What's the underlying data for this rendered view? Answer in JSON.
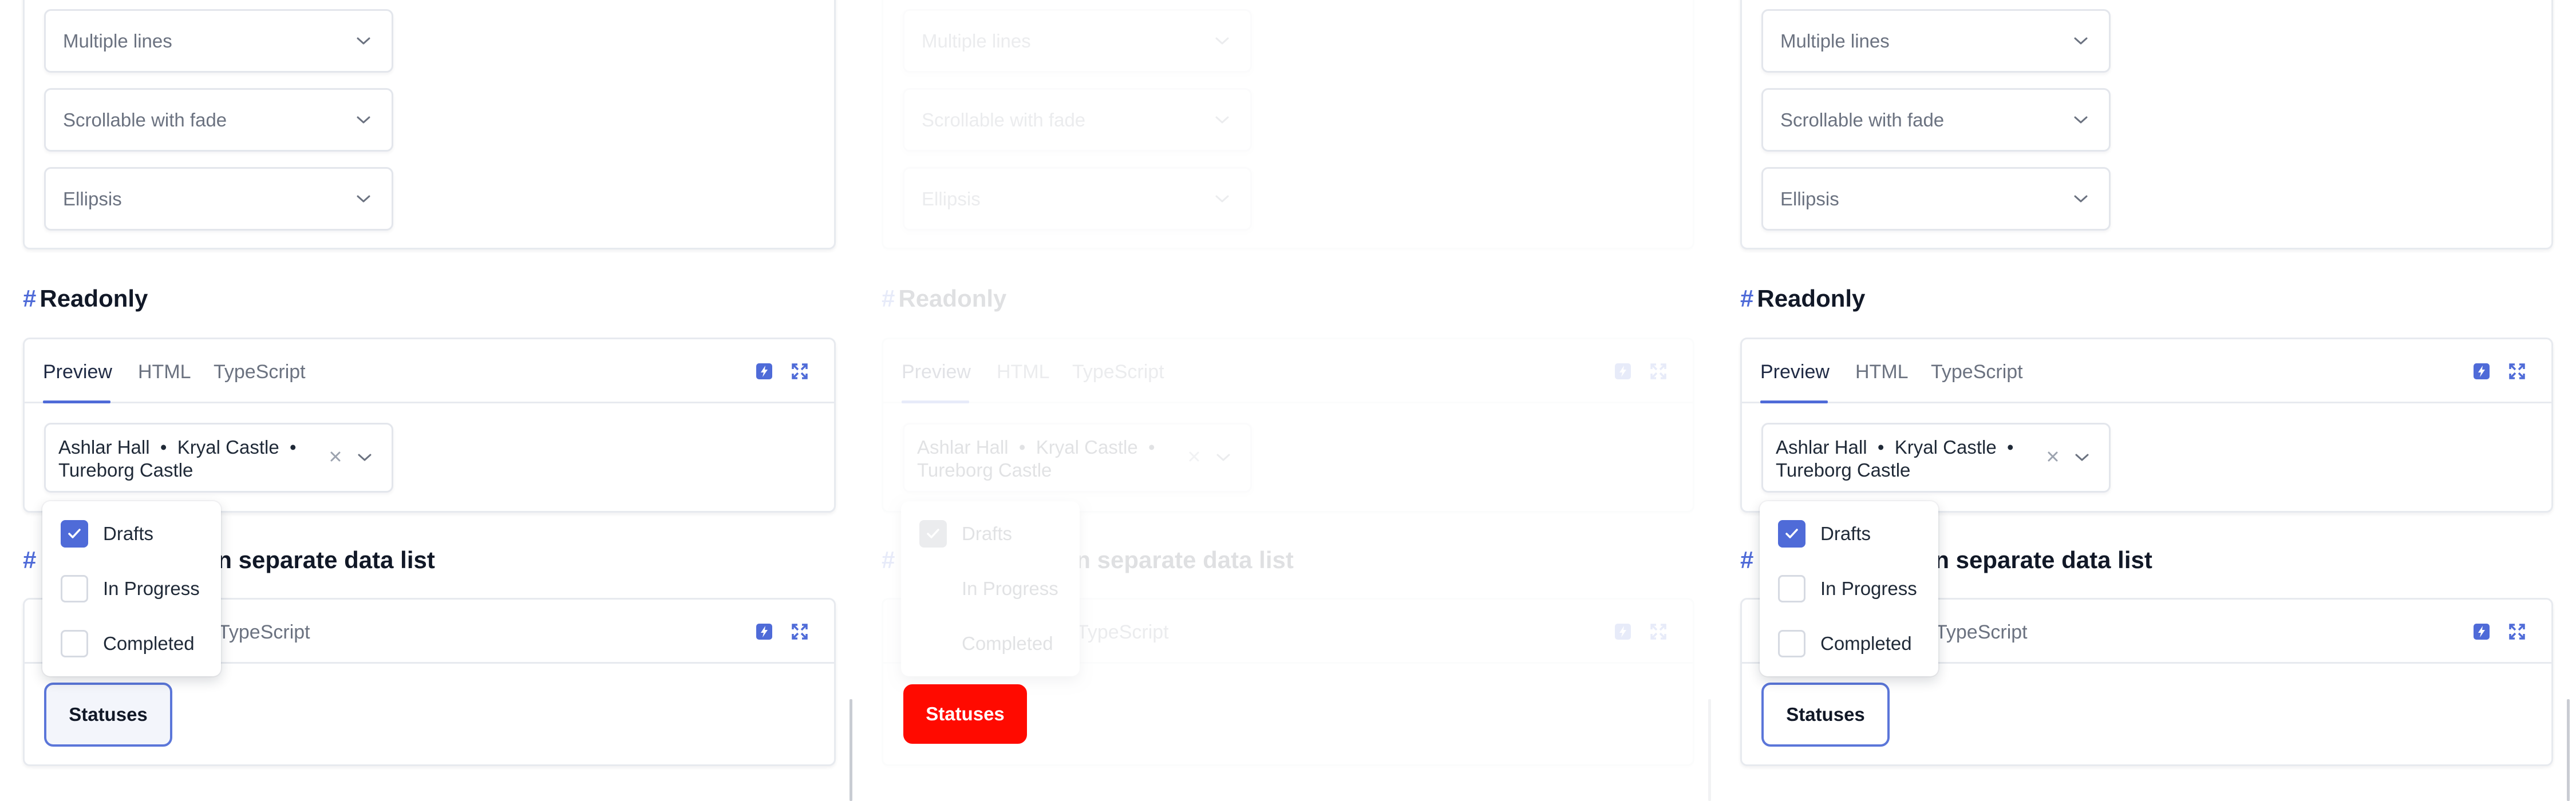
{
  "panels": [
    {
      "id": "left",
      "variant": "normal",
      "top_selects": [
        "Multiple lines",
        "Scrollable with fade",
        "Ellipsis"
      ],
      "readonly_section": {
        "title": "Readonly",
        "tabs": [
          "Preview",
          "HTML",
          "TypeScript"
        ],
        "selected_text": "Ashlar Hall  •  Kryal Castle  •  Tureborg Castle"
      },
      "datalist_section": {
        "title_visible": "n separate data list",
        "tab_visible": "TypeScript",
        "button_label": "Statuses"
      },
      "dropdown": {
        "options": [
          {
            "label": "Drafts",
            "checked": true
          },
          {
            "label": "In Progress",
            "checked": false
          },
          {
            "label": "Completed",
            "checked": false
          }
        ]
      }
    },
    {
      "id": "middle",
      "variant": "faded",
      "top_selects": [
        "Multiple lines",
        "Scrollable with fade",
        "Ellipsis"
      ],
      "readonly_section": {
        "title": "Readonly",
        "tabs": [
          "Preview",
          "HTML",
          "TypeScript"
        ],
        "selected_text": "Ashlar Hall  •  Kryal Castle  •  Tureborg Castle"
      },
      "datalist_section": {
        "title_visible": "n separate data list",
        "tab_visible": "TypeScript",
        "button_label": "Statuses"
      },
      "dropdown": {
        "options": [
          {
            "label": "Drafts",
            "checked": true
          },
          {
            "label": "In Progress",
            "checked": false
          },
          {
            "label": "Completed",
            "checked": false
          }
        ]
      }
    },
    {
      "id": "right",
      "variant": "normal",
      "top_selects": [
        "Multiple lines",
        "Scrollable with fade",
        "Ellipsis"
      ],
      "readonly_section": {
        "title": "Readonly",
        "tabs": [
          "Preview",
          "HTML",
          "TypeScript"
        ],
        "selected_text": "Ashlar Hall  •  Kryal Castle  •  Tureborg Castle"
      },
      "datalist_section": {
        "title_visible": "n separate data list",
        "tab_visible": "TypeScript",
        "button_label": "Statuses"
      },
      "dropdown": {
        "options": [
          {
            "label": "Drafts",
            "checked": true
          },
          {
            "label": "In Progress",
            "checked": false
          },
          {
            "label": "Completed",
            "checked": false
          }
        ]
      }
    }
  ],
  "hash_symbol": "#",
  "colors": {
    "accent": "#4f6bd8",
    "highlight_button": "#ff0a00",
    "border": "#e7eaef",
    "muted_text": "#6b7280"
  },
  "icons": [
    "chevron-down-icon",
    "clear-icon",
    "stackblitz-icon",
    "fullscreen-icon",
    "checkmark-icon"
  ]
}
